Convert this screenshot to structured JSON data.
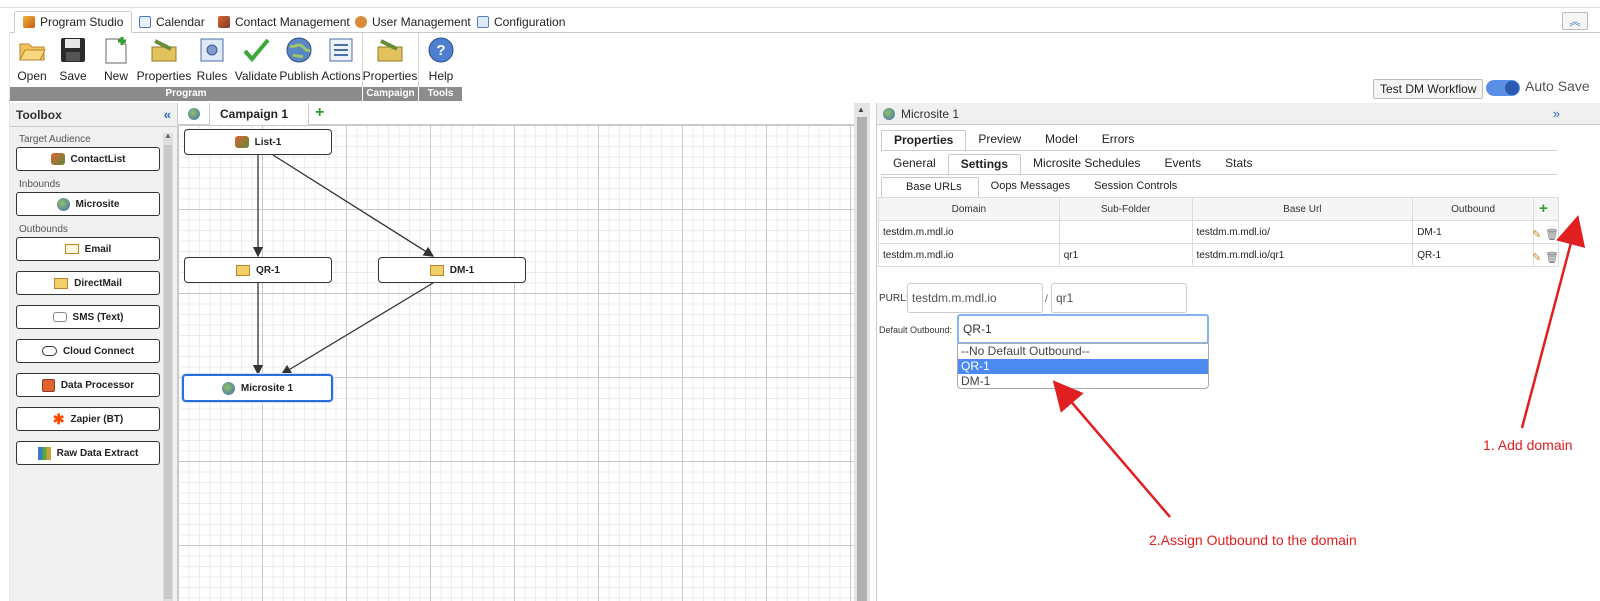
{
  "tabs": [
    {
      "label": "Program Studio",
      "icon": "program-studio-icon"
    },
    {
      "label": "Calendar",
      "icon": "calendar-icon"
    },
    {
      "label": "Contact Management",
      "icon": "contacts-icon"
    },
    {
      "label": "User Management",
      "icon": "user-icon"
    },
    {
      "label": "Configuration",
      "icon": "configuration-icon"
    }
  ],
  "ribbon": {
    "buttons": [
      {
        "label": "Open",
        "icon": "folder-icon"
      },
      {
        "label": "Save",
        "icon": "floppy-icon"
      },
      {
        "label": "New",
        "icon": "new-document-icon"
      },
      {
        "label": "Properties",
        "icon": "properties-icon"
      },
      {
        "label": "Rules",
        "icon": "rules-icon"
      },
      {
        "label": "Validate",
        "icon": "checkmark-icon"
      },
      {
        "label": "Publish",
        "icon": "publish-globe-icon"
      },
      {
        "label": "Actions",
        "icon": "actions-list-icon"
      },
      {
        "label": "Properties",
        "icon": "properties-icon"
      },
      {
        "label": "Help",
        "icon": "help-icon"
      }
    ],
    "groups": [
      "Program",
      "Campaign",
      "Tools"
    ]
  },
  "workflow_button": "Test DM Workflow",
  "autosave_label": "Auto Save",
  "toolbox": {
    "title": "Toolbox",
    "categories": [
      "Target Audience",
      "Inbounds",
      "Outbounds"
    ],
    "items": [
      "ContactList",
      "Microsite",
      "Email",
      "DirectMail",
      "SMS (Text)",
      "Cloud Connect",
      "Data Processor",
      "Zapier (BT)",
      "Raw Data Extract"
    ]
  },
  "canvas": {
    "tab": "Campaign 1",
    "nodes": [
      "List-1",
      "QR-1",
      "DM-1",
      "Microsite 1"
    ]
  },
  "panel": {
    "title": "Microsite 1",
    "tabs1": [
      "Properties",
      "Preview",
      "Model",
      "Errors"
    ],
    "tabs2": [
      "General",
      "Settings",
      "Microsite Schedules",
      "Events",
      "Stats"
    ],
    "tabs3": [
      "Base URLs",
      "Oops Messages",
      "Session Controls"
    ],
    "table": {
      "headers": [
        "Domain",
        "Sub-Folder",
        "Base Url",
        "Outbound"
      ],
      "rows": [
        [
          "testdm.m.mdl.io",
          "",
          "testdm.m.mdl.io/",
          "DM-1"
        ],
        [
          "testdm.m.mdl.io",
          "qr1",
          "testdm.m.mdl.io/qr1",
          "QR-1"
        ]
      ]
    },
    "purl_label": "PURL:",
    "purl_domain": "testdm.m.mdl.io",
    "purl_slash": "/",
    "purl_folder": "qr1",
    "default_outbound_label": "Default Outbound:",
    "default_outbound_value": "QR-1",
    "options": [
      "--No Default Outbound--",
      "QR-1",
      "DM-1"
    ]
  },
  "annotations": {
    "add_domain": "1. Add domain",
    "assign": "2.Assign Outbound to the domain",
    "color": "#e02020"
  }
}
